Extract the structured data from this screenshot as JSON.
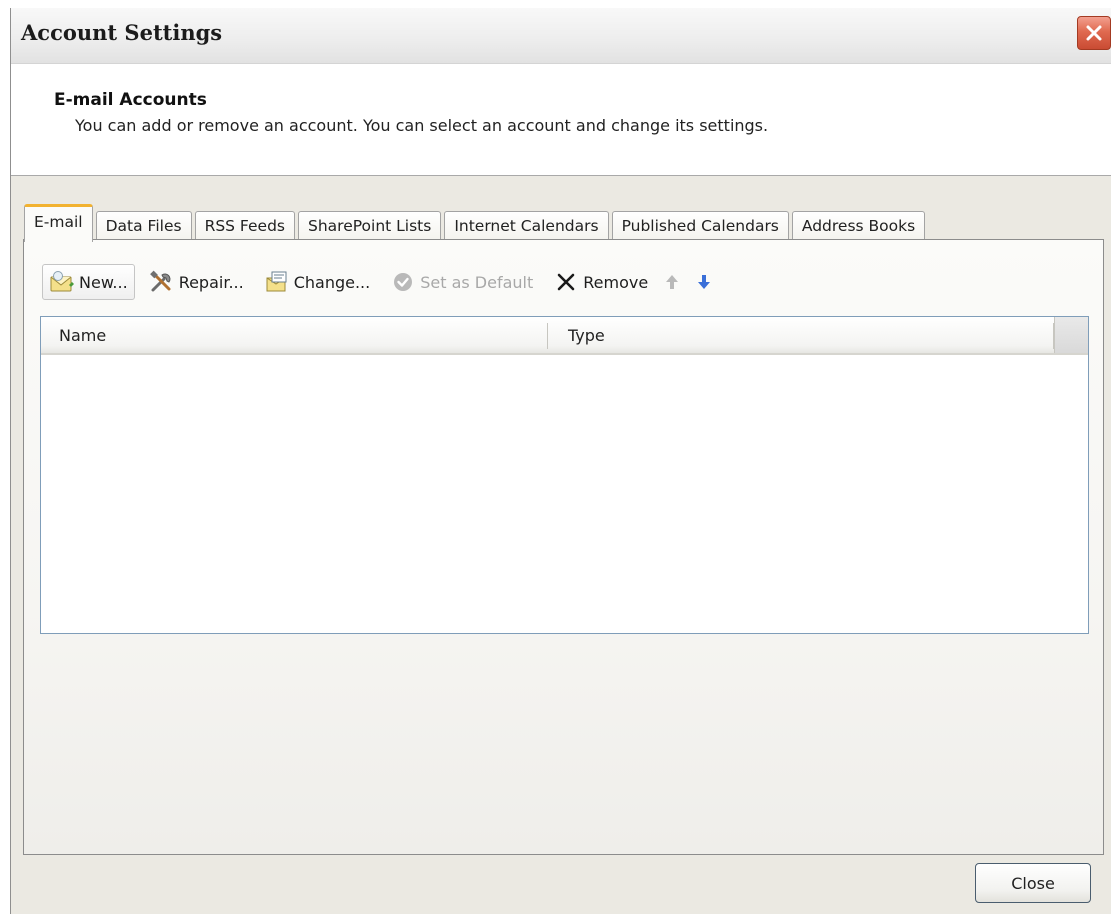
{
  "window": {
    "title": "Account Settings"
  },
  "header": {
    "title": "E-mail Accounts",
    "description": "You can add or remove an account. You can select an account and change its settings."
  },
  "tabs": [
    {
      "label": "E-mail",
      "active": true
    },
    {
      "label": "Data Files",
      "active": false
    },
    {
      "label": "RSS Feeds",
      "active": false
    },
    {
      "label": "SharePoint Lists",
      "active": false
    },
    {
      "label": "Internet Calendars",
      "active": false
    },
    {
      "label": "Published Calendars",
      "active": false
    },
    {
      "label": "Address Books",
      "active": false
    }
  ],
  "toolbar": {
    "new_label": "New...",
    "repair_label": "Repair...",
    "change_label": "Change...",
    "set_default_label": "Set as Default",
    "remove_label": "Remove",
    "icons": [
      "new-account-icon",
      "repair-icon",
      "change-icon",
      "set-default-icon",
      "remove-icon",
      "move-up-icon",
      "move-down-icon"
    ]
  },
  "account_list": {
    "columns": [
      "Name",
      "Type"
    ],
    "rows": []
  },
  "footer": {
    "close_label": "Close"
  },
  "colors": {
    "active_tab_accent": "#f2b230",
    "close_x_red": "#d9553b",
    "list_border": "#7f9db9",
    "arrow_blue": "#3a6fd8"
  }
}
